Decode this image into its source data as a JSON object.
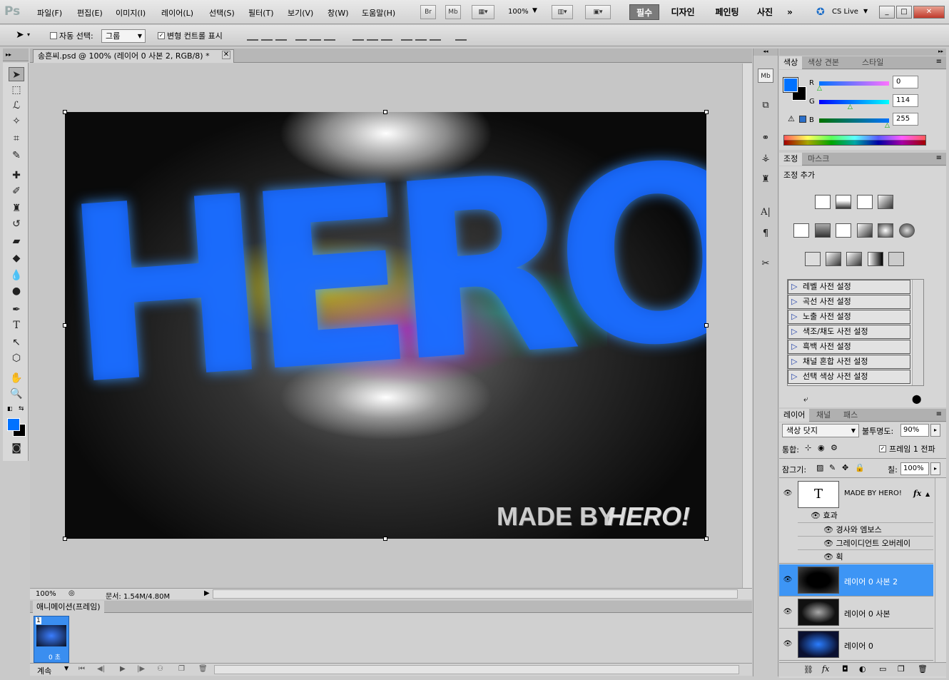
{
  "menubar": {
    "logo": "Ps",
    "items": [
      "파일(F)",
      "편집(E)",
      "이미지(I)",
      "레이어(L)",
      "선택(S)",
      "필터(T)",
      "보기(V)",
      "창(W)",
      "도움말(H)"
    ],
    "br": "Br",
    "mb": "Mb",
    "zoom": "100%",
    "workspaces": [
      "필수",
      "디자인",
      "페인팅",
      "사진"
    ],
    "more": "»",
    "cslive": "CS Live"
  },
  "options": {
    "auto_select_label": "자동 선택:",
    "auto_select_value": "그룹",
    "transform_label": "변형 컨트롤 표시"
  },
  "document": {
    "tab_title": "송흔씨.psd @ 100% (레이어 0 사본 2, RGB/8) *",
    "zoom": "100%",
    "doc_size": "문서: 1.54M/4.80M",
    "art_title": "HERO!",
    "credit_a": "MADE BY",
    "credit_b": "HERO!"
  },
  "animation": {
    "title": "애니메이션(프레임)",
    "frame_number": "1",
    "frame_delay": "0 초",
    "loop": "계속"
  },
  "color_panel": {
    "tabs": [
      "색상",
      "색상 견본",
      "스타일"
    ],
    "r_label": "R",
    "g_label": "G",
    "b_label": "B",
    "r": "0",
    "g": "114",
    "b": "255",
    "foreground": "#0072ff"
  },
  "adjust_panel": {
    "tabs": [
      "조정",
      "마스크"
    ],
    "title": "조정 추가",
    "presets": [
      "레벨 사전 설정",
      "곡선 사전 설정",
      "노출 사전 설정",
      "색조/채도 사전 설정",
      "흑백 사전 설정",
      "채널 혼합 사전 설정",
      "선택 색상 사전 설정"
    ]
  },
  "layers_panel": {
    "tabs": [
      "레이어",
      "채널",
      "패스"
    ],
    "blend_mode": "색상 닷지",
    "opacity_label": "불투명도:",
    "opacity": "90%",
    "unify_label": "통합:",
    "propagate_label": "프레임 1 전파",
    "lock_label": "잠그기:",
    "fill_label": "칠:",
    "fill": "100%",
    "text_layer": "MADE BY HERO!",
    "effects_label": "효과",
    "effects": [
      "경사와 엠보스",
      "그레이디언트 오버레이",
      "획"
    ],
    "layers": [
      "레이어 0 사본 2",
      "레이어 0 사본",
      "레이어 0"
    ],
    "selected_color": "#3d95f5"
  }
}
